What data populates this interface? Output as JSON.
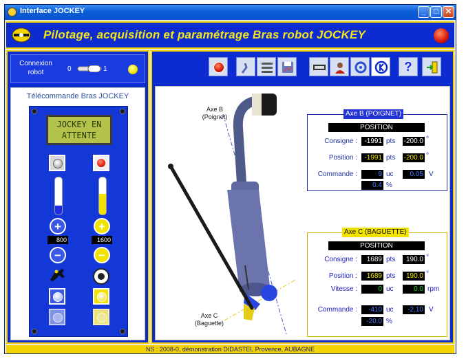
{
  "window": {
    "title": "Interface JOCKEY",
    "minimize": "_",
    "maximize": "□",
    "close": "✕"
  },
  "banner": {
    "title": "Pilotage, acquisition et paramétrage Bras robot JOCKEY",
    "logo_icon": "robot-logo-icon",
    "stop_icon": "emergency-stop-icon"
  },
  "connexion": {
    "label_line1": "Connexion",
    "label_line2": "robot",
    "zero": "0",
    "one": "1",
    "led_color": "#f2e300"
  },
  "toolbar": {
    "icons": [
      "stop-red-icon",
      "arm-icon",
      "parameters-icon",
      "disk-save-icon",
      "numeric-display-icon",
      "operator-icon",
      "calibrate-icon",
      "jockey-logo-icon",
      "help-icon",
      "exit-icon"
    ],
    "help_label": "?"
  },
  "telecommande": {
    "title": "Télécommande Bras JOCKEY",
    "lcd_line1": "JOCKEY EN",
    "lcd_line2": "ATTENTE",
    "left_value": "800",
    "right_value": "1600",
    "left_gauge_level": 0.25,
    "right_gauge_level": 0.55,
    "plus": "+",
    "minus": "−"
  },
  "axe_b": {
    "title": "Axe B (POIGNET)",
    "position_header": "POSITION",
    "consigne_label": "Consigne :",
    "consigne_pts": "-1991",
    "consigne_deg": "-200.0",
    "position_label": "Position :",
    "position_pts": "-1991",
    "position_deg": "-200.0",
    "commande_label": "Commande :",
    "commande_uc": "9",
    "commande_v": "0.05",
    "commande_pct": "0.4",
    "pts": "pts",
    "deg": "°",
    "uc": "uc",
    "v": "V",
    "pct": "%"
  },
  "axe_c": {
    "title": "Axe C (BAGUETTE)",
    "position_header": "POSITION",
    "consigne_label": "Consigne :",
    "consigne_pts": "1689",
    "consigne_deg": "190.0",
    "position_label": "Position :",
    "position_pts": "1689",
    "position_deg": "190.0",
    "vitesse_label": "Vitesse :",
    "vitesse_uc": "0",
    "vitesse_rpm": "0.0",
    "commande_label": "Commande :",
    "commande_uc": "-410",
    "commande_v": "-2.10",
    "commande_pct": "-20.0",
    "pts": "pts",
    "deg": "°",
    "uc": "uc",
    "rpm": "rpm",
    "v": "V",
    "pct": "%"
  },
  "view": {
    "axe_b_line1": "Axe B",
    "axe_b_line2": "(Poignet)",
    "axe_c_line1": "Axe C",
    "axe_c_line2": "(Baguette)"
  },
  "status_bar": "NS : 2008-0, démonstration DIDASTEL Provence, AUBAGNE"
}
